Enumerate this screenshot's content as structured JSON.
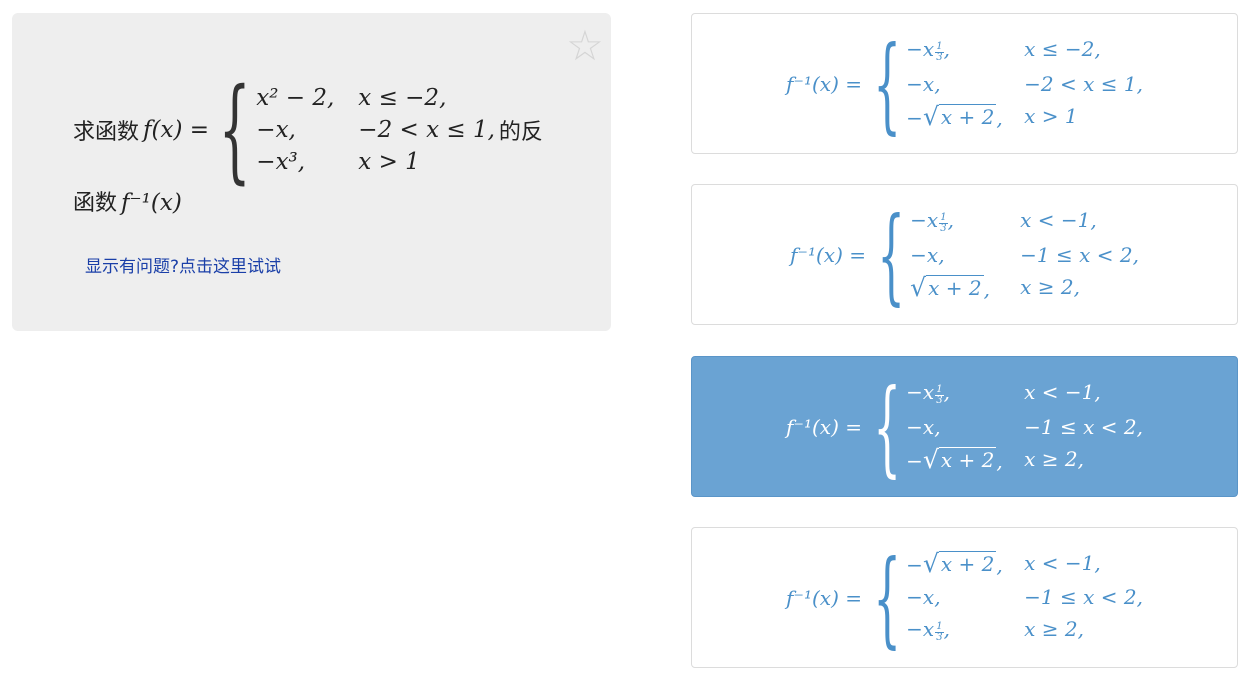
{
  "question": {
    "prefix": "求函数",
    "fx": "f(x) =",
    "cases": [
      {
        "expr": "x² − 2,",
        "cond": "x ≤ −2,"
      },
      {
        "expr": "−x,",
        "cond": "−2 < x ≤ 1,"
      },
      {
        "expr": "−x³,",
        "cond": "x > 1"
      }
    ],
    "suffix": "的反",
    "line2_prefix": "函数",
    "line2_math": "f⁻¹(x)",
    "problem_link": "显示有问题?点击这里试试"
  },
  "options": [
    {
      "lhs": "f⁻¹(x) =",
      "selected": false,
      "cases": [
        {
          "expr_type": "cuberoot",
          "sign": "−x",
          "cond": "x ≤ −2,"
        },
        {
          "expr": "−x,",
          "cond": "−2 < x ≤ 1,"
        },
        {
          "expr_type": "sqrt",
          "sign": "−",
          "arg": "x + 2",
          "tail": ",",
          "cond": "x > 1"
        }
      ]
    },
    {
      "lhs": "f⁻¹(x) =",
      "selected": false,
      "cases": [
        {
          "expr_type": "cuberoot",
          "sign": "−x",
          "cond": "x < −1,"
        },
        {
          "expr": "−x,",
          "cond": "−1 ≤ x < 2,"
        },
        {
          "expr_type": "sqrt",
          "sign": "",
          "arg": "x + 2",
          "tail": ",",
          "cond": "x ≥ 2,"
        }
      ]
    },
    {
      "lhs": "f⁻¹(x) =",
      "selected": true,
      "cases": [
        {
          "expr_type": "cuberoot",
          "sign": "−x",
          "cond": "x < −1,"
        },
        {
          "expr": "−x,",
          "cond": "−1 ≤ x < 2,"
        },
        {
          "expr_type": "sqrt",
          "sign": "−",
          "arg": "x + 2",
          "tail": ",",
          "cond": "x ≥ 2,"
        }
      ]
    },
    {
      "lhs": "f⁻¹(x) =",
      "selected": false,
      "cases": [
        {
          "expr_type": "sqrt",
          "sign": "−",
          "arg": "x + 2",
          "tail": ",",
          "cond": "x < −1,"
        },
        {
          "expr": "−x,",
          "cond": "−1 ≤ x < 2,"
        },
        {
          "expr_type": "cuberoot",
          "sign": "−x",
          "cond": "x ≥ 2,"
        }
      ]
    }
  ],
  "cuberoot": {
    "num": "1",
    "den": "3"
  },
  "colors": {
    "option_text": "#4a90c9",
    "selected_bg": "#6aa3d3",
    "card_bg": "#eeeeee",
    "link": "#1a3fa8"
  },
  "icons": {
    "favorite": "star-outline-icon"
  }
}
